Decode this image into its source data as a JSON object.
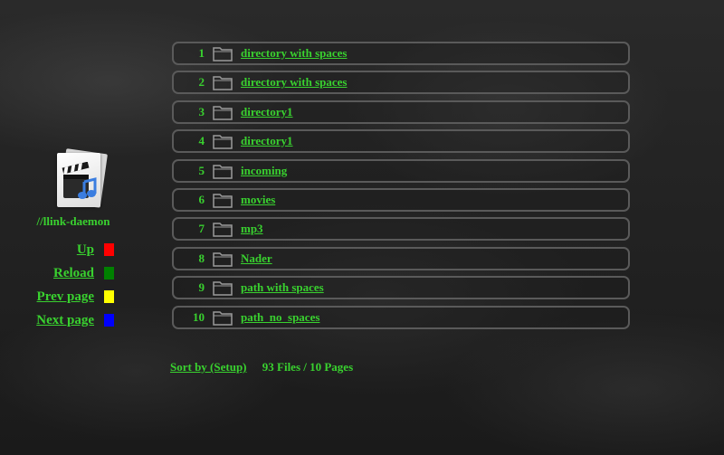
{
  "sidebar": {
    "host": "//llink-daemon",
    "nav": [
      {
        "label": "Up",
        "color": "#ff0000",
        "icon": "red-square"
      },
      {
        "label": "Reload",
        "color": "#008000",
        "icon": "green-square"
      },
      {
        "label": "Prev page",
        "color": "#ffff00",
        "icon": "yellow-square"
      },
      {
        "label": "Next page",
        "color": "#0000ff",
        "icon": "blue-square"
      }
    ]
  },
  "files": [
    {
      "num": "1",
      "name": "directory with spaces",
      "icon": "folder-icon"
    },
    {
      "num": "2",
      "name": "directory with spaces",
      "icon": "folder-icon"
    },
    {
      "num": "3",
      "name": "directory1",
      "icon": "folder-icon"
    },
    {
      "num": "4",
      "name": "directory1",
      "icon": "folder-icon"
    },
    {
      "num": "5",
      "name": "incoming",
      "icon": "folder-icon"
    },
    {
      "num": "6",
      "name": "movies",
      "icon": "folder-icon"
    },
    {
      "num": "7",
      "name": "mp3",
      "icon": "folder-icon"
    },
    {
      "num": "8",
      "name": "Nader",
      "icon": "folder-icon"
    },
    {
      "num": "9",
      "name": "path with spaces",
      "icon": "folder-icon"
    },
    {
      "num": "10",
      "name": "path_no_spaces",
      "icon": "folder-icon"
    }
  ],
  "footer": {
    "sort_label": "Sort by (Setup)",
    "summary": "93 Files / 10 Pages"
  },
  "colors": {
    "text": "#39d12f",
    "row_border": "#5a5a5a"
  }
}
